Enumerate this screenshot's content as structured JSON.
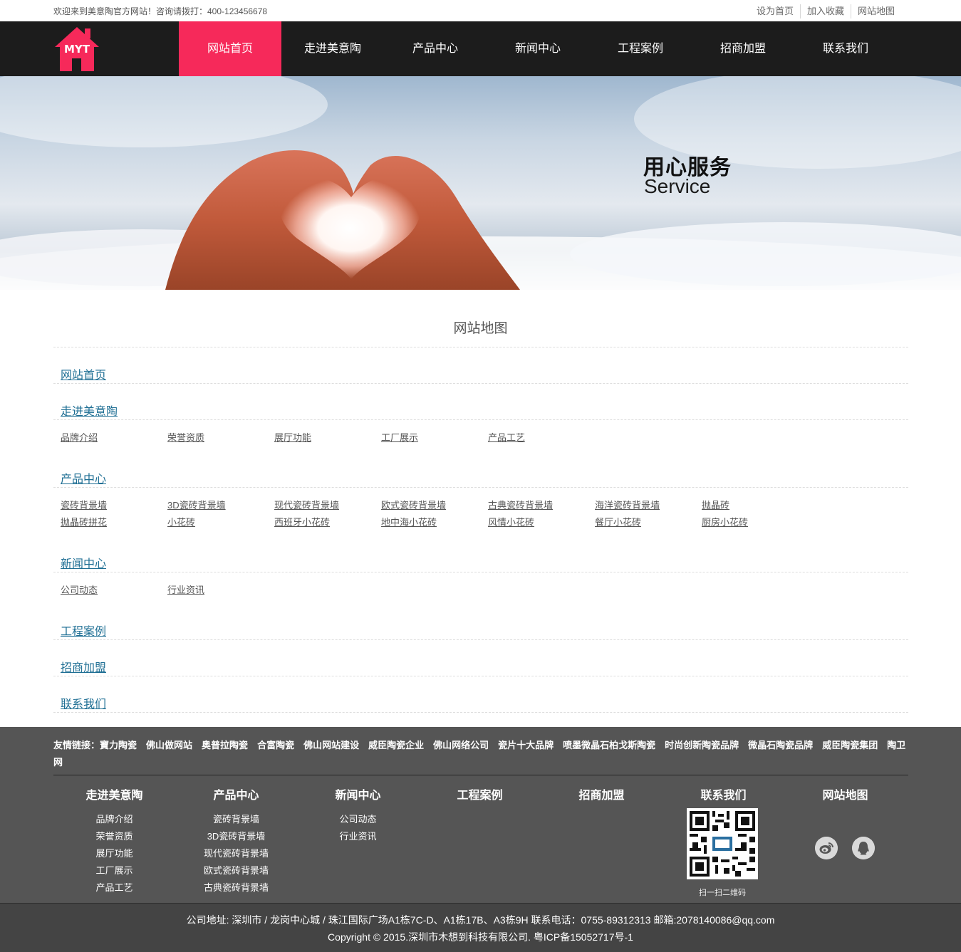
{
  "topbar": {
    "welcome": "欢迎来到美意陶官方网站！咨询请拨打：400-123456678",
    "links": [
      "设为首页",
      "加入收藏",
      "网站地图"
    ]
  },
  "logo": {
    "text": "MYT",
    "color": "#f6295a"
  },
  "nav": [
    "网站首页",
    "走进美意陶",
    "产品中心",
    "新闻中心",
    "工程案例",
    "招商加盟",
    "联系我们"
  ],
  "banner": {
    "slogan": "用心服务",
    "slogan_en": "Service"
  },
  "sitemap": {
    "title": "网站地图",
    "sections": [
      {
        "title": "网站首页",
        "items": []
      },
      {
        "title": "走进美意陶",
        "items": [
          "品牌介绍",
          "荣誉资质",
          "展厅功能",
          "工厂展示",
          "产品工艺"
        ]
      },
      {
        "title": "产品中心",
        "items": [
          "瓷砖背景墙",
          "3D瓷砖背景墙",
          "现代瓷砖背景墙",
          "欧式瓷砖背景墙",
          "古典瓷砖背景墙",
          "海洋瓷砖背景墙",
          "抛晶砖",
          "抛晶砖拼花",
          "小花砖",
          "西班牙小花砖",
          "地中海小花砖",
          "风情小花砖",
          "餐厅小花砖",
          "厨房小花砖"
        ]
      },
      {
        "title": "新闻中心",
        "items": [
          "公司动态",
          "行业资讯"
        ]
      },
      {
        "title": "工程案例",
        "items": []
      },
      {
        "title": "招商加盟",
        "items": []
      },
      {
        "title": "联系我们",
        "items": []
      }
    ]
  },
  "footer": {
    "friend_label": "友情链接：",
    "friend_links": [
      "寶力陶瓷",
      "佛山做网站",
      "奥普拉陶瓷",
      "合富陶瓷",
      "佛山网站建设",
      "威臣陶瓷企业",
      "佛山网络公司",
      "瓷片十大品牌",
      "喷墨微晶石柏戈斯陶瓷",
      "时尚创新陶瓷品牌",
      "微晶石陶瓷品牌",
      "威臣陶瓷集团",
      "陶卫网"
    ],
    "columns": [
      {
        "title": "走进美意陶",
        "items": [
          "品牌介绍",
          "荣誉资质",
          "展厅功能",
          "工厂展示",
          "产品工艺"
        ]
      },
      {
        "title": "产品中心",
        "items": [
          "瓷砖背景墙",
          "3D瓷砖背景墙",
          "现代瓷砖背景墙",
          "欧式瓷砖背景墙",
          "古典瓷砖背景墙"
        ]
      },
      {
        "title": "新闻中心",
        "items": [
          "公司动态",
          "行业资讯"
        ]
      },
      {
        "title": "工程案例",
        "items": []
      },
      {
        "title": "招商加盟",
        "items": []
      },
      {
        "title": "联系我们",
        "items": []
      },
      {
        "title": "网站地图",
        "items": []
      }
    ],
    "qr_caption": "扫一扫二维码",
    "address": "公司地址: 深圳市 / 龙岗中心城 / 珠江国际广场A1栋7C-D、A1栋17B、A3栋9H 联系电话：0755-89312313 邮箱:2078140086@qq.com",
    "copyright": "Copyright © 2015.深圳市木想到科技有限公司. 粤ICP备15052717号-1"
  }
}
